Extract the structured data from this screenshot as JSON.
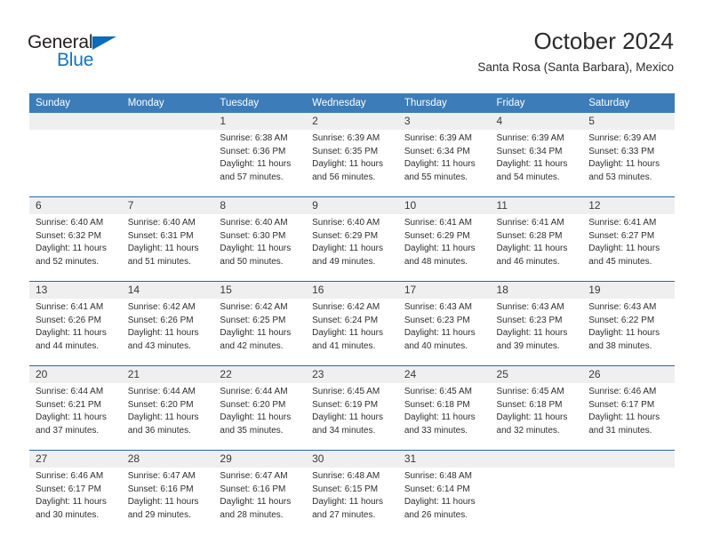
{
  "logo": {
    "word_top": "General",
    "word_bottom": "Blue",
    "triangle_icon": "triangle-icon",
    "colors": {
      "dark": "#231f20",
      "blue": "#0b75c9",
      "triangle": "#0b6cb7"
    }
  },
  "header": {
    "title": "October 2024",
    "subtitle": "Santa Rosa (Santa Barbara), Mexico"
  },
  "colors": {
    "header_row_bg": "#3c7cb9",
    "day_number_bg": "#efefef",
    "week_separator": "#1f6aad",
    "page_bg": "#ffffff",
    "text": "#2e2e2e"
  },
  "weekday_headers": [
    "Sunday",
    "Monday",
    "Tuesday",
    "Wednesday",
    "Thursday",
    "Friday",
    "Saturday"
  ],
  "labels": {
    "sunrise_prefix": "Sunrise:",
    "sunset_prefix": "Sunset:",
    "daylight_prefix": "Daylight:"
  },
  "weeks": [
    [
      {
        "day": "",
        "lines": [
          "",
          "",
          "",
          ""
        ]
      },
      {
        "day": "",
        "lines": [
          "",
          "",
          "",
          ""
        ]
      },
      {
        "day": "1",
        "lines": [
          "Sunrise: 6:38 AM",
          "Sunset: 6:36 PM",
          "Daylight: 11 hours",
          "and 57 minutes."
        ]
      },
      {
        "day": "2",
        "lines": [
          "Sunrise: 6:39 AM",
          "Sunset: 6:35 PM",
          "Daylight: 11 hours",
          "and 56 minutes."
        ]
      },
      {
        "day": "3",
        "lines": [
          "Sunrise: 6:39 AM",
          "Sunset: 6:34 PM",
          "Daylight: 11 hours",
          "and 55 minutes."
        ]
      },
      {
        "day": "4",
        "lines": [
          "Sunrise: 6:39 AM",
          "Sunset: 6:34 PM",
          "Daylight: 11 hours",
          "and 54 minutes."
        ]
      },
      {
        "day": "5",
        "lines": [
          "Sunrise: 6:39 AM",
          "Sunset: 6:33 PM",
          "Daylight: 11 hours",
          "and 53 minutes."
        ]
      }
    ],
    [
      {
        "day": "6",
        "lines": [
          "Sunrise: 6:40 AM",
          "Sunset: 6:32 PM",
          "Daylight: 11 hours",
          "and 52 minutes."
        ]
      },
      {
        "day": "7",
        "lines": [
          "Sunrise: 6:40 AM",
          "Sunset: 6:31 PM",
          "Daylight: 11 hours",
          "and 51 minutes."
        ]
      },
      {
        "day": "8",
        "lines": [
          "Sunrise: 6:40 AM",
          "Sunset: 6:30 PM",
          "Daylight: 11 hours",
          "and 50 minutes."
        ]
      },
      {
        "day": "9",
        "lines": [
          "Sunrise: 6:40 AM",
          "Sunset: 6:29 PM",
          "Daylight: 11 hours",
          "and 49 minutes."
        ]
      },
      {
        "day": "10",
        "lines": [
          "Sunrise: 6:41 AM",
          "Sunset: 6:29 PM",
          "Daylight: 11 hours",
          "and 48 minutes."
        ]
      },
      {
        "day": "11",
        "lines": [
          "Sunrise: 6:41 AM",
          "Sunset: 6:28 PM",
          "Daylight: 11 hours",
          "and 46 minutes."
        ]
      },
      {
        "day": "12",
        "lines": [
          "Sunrise: 6:41 AM",
          "Sunset: 6:27 PM",
          "Daylight: 11 hours",
          "and 45 minutes."
        ]
      }
    ],
    [
      {
        "day": "13",
        "lines": [
          "Sunrise: 6:41 AM",
          "Sunset: 6:26 PM",
          "Daylight: 11 hours",
          "and 44 minutes."
        ]
      },
      {
        "day": "14",
        "lines": [
          "Sunrise: 6:42 AM",
          "Sunset: 6:26 PM",
          "Daylight: 11 hours",
          "and 43 minutes."
        ]
      },
      {
        "day": "15",
        "lines": [
          "Sunrise: 6:42 AM",
          "Sunset: 6:25 PM",
          "Daylight: 11 hours",
          "and 42 minutes."
        ]
      },
      {
        "day": "16",
        "lines": [
          "Sunrise: 6:42 AM",
          "Sunset: 6:24 PM",
          "Daylight: 11 hours",
          "and 41 minutes."
        ]
      },
      {
        "day": "17",
        "lines": [
          "Sunrise: 6:43 AM",
          "Sunset: 6:23 PM",
          "Daylight: 11 hours",
          "and 40 minutes."
        ]
      },
      {
        "day": "18",
        "lines": [
          "Sunrise: 6:43 AM",
          "Sunset: 6:23 PM",
          "Daylight: 11 hours",
          "and 39 minutes."
        ]
      },
      {
        "day": "19",
        "lines": [
          "Sunrise: 6:43 AM",
          "Sunset: 6:22 PM",
          "Daylight: 11 hours",
          "and 38 minutes."
        ]
      }
    ],
    [
      {
        "day": "20",
        "lines": [
          "Sunrise: 6:44 AM",
          "Sunset: 6:21 PM",
          "Daylight: 11 hours",
          "and 37 minutes."
        ]
      },
      {
        "day": "21",
        "lines": [
          "Sunrise: 6:44 AM",
          "Sunset: 6:20 PM",
          "Daylight: 11 hours",
          "and 36 minutes."
        ]
      },
      {
        "day": "22",
        "lines": [
          "Sunrise: 6:44 AM",
          "Sunset: 6:20 PM",
          "Daylight: 11 hours",
          "and 35 minutes."
        ]
      },
      {
        "day": "23",
        "lines": [
          "Sunrise: 6:45 AM",
          "Sunset: 6:19 PM",
          "Daylight: 11 hours",
          "and 34 minutes."
        ]
      },
      {
        "day": "24",
        "lines": [
          "Sunrise: 6:45 AM",
          "Sunset: 6:18 PM",
          "Daylight: 11 hours",
          "and 33 minutes."
        ]
      },
      {
        "day": "25",
        "lines": [
          "Sunrise: 6:45 AM",
          "Sunset: 6:18 PM",
          "Daylight: 11 hours",
          "and 32 minutes."
        ]
      },
      {
        "day": "26",
        "lines": [
          "Sunrise: 6:46 AM",
          "Sunset: 6:17 PM",
          "Daylight: 11 hours",
          "and 31 minutes."
        ]
      }
    ],
    [
      {
        "day": "27",
        "lines": [
          "Sunrise: 6:46 AM",
          "Sunset: 6:17 PM",
          "Daylight: 11 hours",
          "and 30 minutes."
        ]
      },
      {
        "day": "28",
        "lines": [
          "Sunrise: 6:47 AM",
          "Sunset: 6:16 PM",
          "Daylight: 11 hours",
          "and 29 minutes."
        ]
      },
      {
        "day": "29",
        "lines": [
          "Sunrise: 6:47 AM",
          "Sunset: 6:16 PM",
          "Daylight: 11 hours",
          "and 28 minutes."
        ]
      },
      {
        "day": "30",
        "lines": [
          "Sunrise: 6:48 AM",
          "Sunset: 6:15 PM",
          "Daylight: 11 hours",
          "and 27 minutes."
        ]
      },
      {
        "day": "31",
        "lines": [
          "Sunrise: 6:48 AM",
          "Sunset: 6:14 PM",
          "Daylight: 11 hours",
          "and 26 minutes."
        ]
      },
      {
        "day": "",
        "lines": [
          "",
          "",
          "",
          ""
        ]
      },
      {
        "day": "",
        "lines": [
          "",
          "",
          "",
          ""
        ]
      }
    ]
  ]
}
